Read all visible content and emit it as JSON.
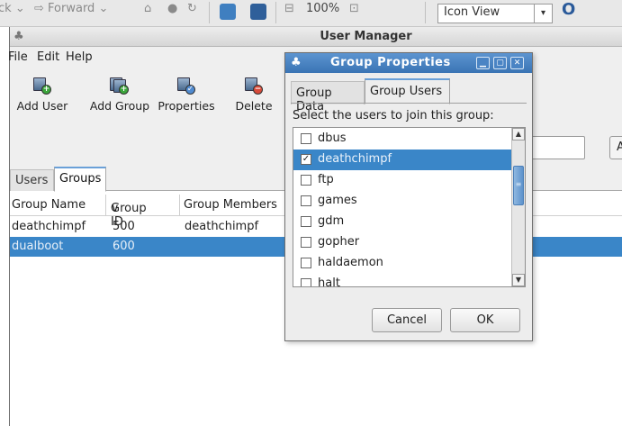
{
  "browser_toolbar": {
    "back_label": "ck",
    "forward_label": "Forward",
    "zoom": "100%",
    "view_mode": "Icon View"
  },
  "window": {
    "title": "User Manager"
  },
  "menu": [
    "File",
    "Edit",
    "Help"
  ],
  "toolbar": {
    "add_user": "Add User",
    "add_group": "Add Group",
    "properties": "Properties",
    "delete": "Delete"
  },
  "search": {
    "apply_label": "A"
  },
  "tabs": [
    "Users",
    "Groups"
  ],
  "group_table": {
    "columns": [
      "Group Name",
      "Group ID",
      "Group Members"
    ],
    "sort_indicator": "∨",
    "rows": [
      {
        "name": "deathchimpf",
        "id": "500",
        "members": "deathchimpf",
        "selected": false
      },
      {
        "name": "dualboot",
        "id": "600",
        "members": "",
        "selected": true
      }
    ]
  },
  "dialog": {
    "title": "Group Properties",
    "tabs": [
      "Group Data",
      "Group Users"
    ],
    "prompt": "Select the users to join this group:",
    "users": [
      {
        "name": "dbus",
        "checked": false,
        "selected": false
      },
      {
        "name": "deathchimpf",
        "checked": true,
        "selected": true
      },
      {
        "name": "ftp",
        "checked": false,
        "selected": false
      },
      {
        "name": "games",
        "checked": false,
        "selected": false
      },
      {
        "name": "gdm",
        "checked": false,
        "selected": false
      },
      {
        "name": "gopher",
        "checked": false,
        "selected": false
      },
      {
        "name": "haldaemon",
        "checked": false,
        "selected": false
      },
      {
        "name": "halt",
        "checked": false,
        "selected": false
      }
    ],
    "cancel": "Cancel",
    "ok": "OK"
  },
  "colors": {
    "selection": "#3a86c8",
    "dialog_title": "#4a84c4"
  }
}
